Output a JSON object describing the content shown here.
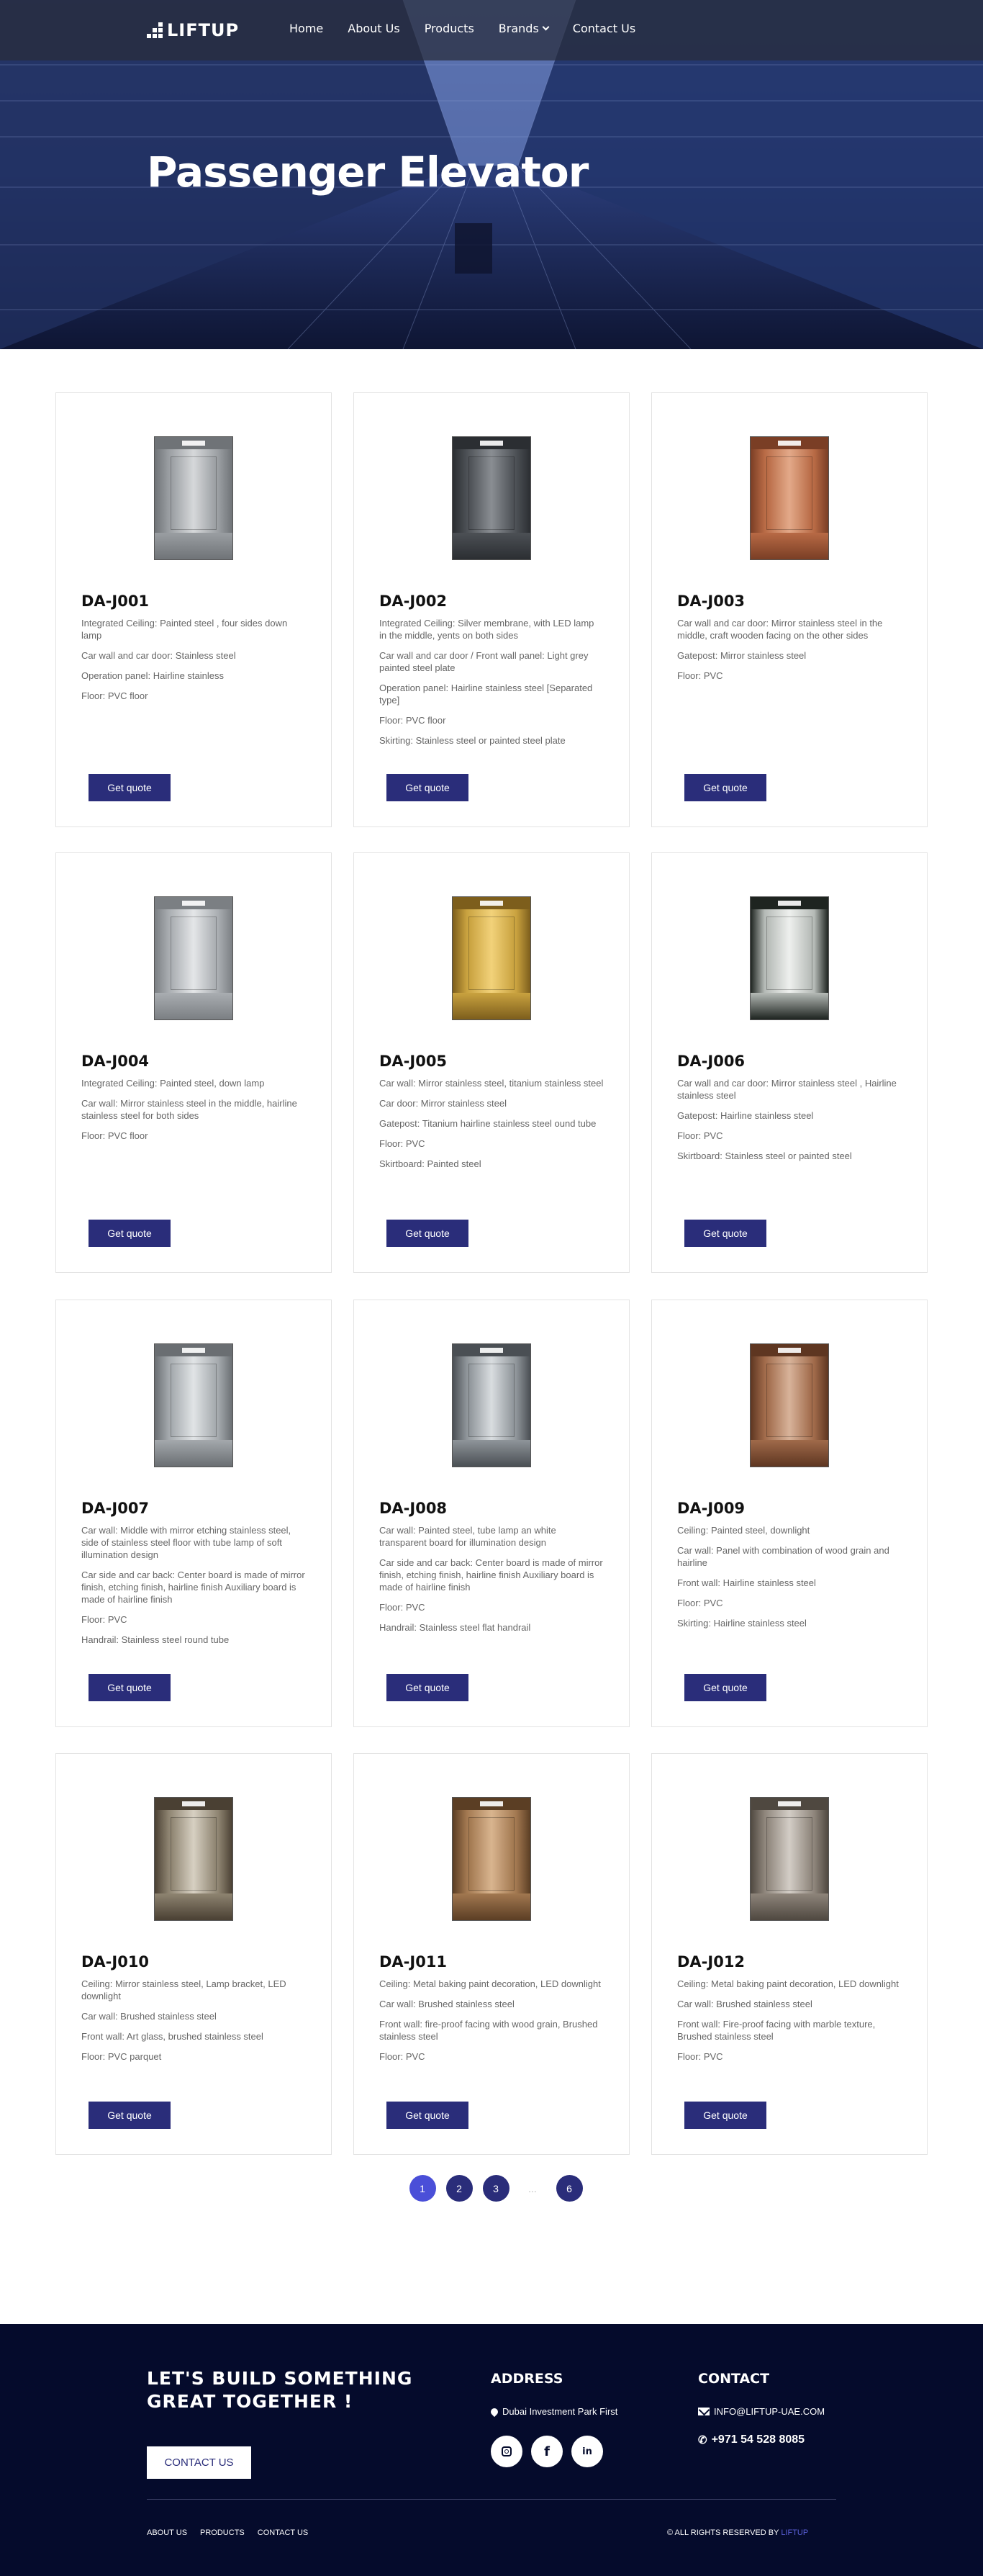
{
  "header": {
    "logo_text": "LIFTUP",
    "nav": [
      {
        "label": "Home"
      },
      {
        "label": "About Us"
      },
      {
        "label": "Products"
      },
      {
        "label": "Brands"
      },
      {
        "label": "Contact Us"
      }
    ],
    "title": "Passenger Elevator"
  },
  "products": [
    {
      "code": "DA-J001",
      "specs": [
        "Integrated Ceiling: Painted steel , four sides down lamp",
        "Car wall and car door: Stainless steel",
        "Operation panel: Hairline stainless",
        "Floor: PVC floor"
      ],
      "button": "Get quote",
      "tone": [
        "#d6d8da",
        "#9a9ea2",
        "#6f7377"
      ]
    },
    {
      "code": "DA-J002",
      "specs": [
        "Integrated Ceiling: Silver membrane, with LED lamp in the middle, yents on both sides",
        "Car wall and car door / Front wall panel: Light grey painted steel plate",
        "Operation panel: Hairline stainless steel [Separated type]",
        "Floor: PVC floor",
        "Skirting: Stainless steel or painted steel plate"
      ],
      "button": "Get quote",
      "tone": [
        "#8a8e93",
        "#4c5055",
        "#2b2e32"
      ]
    },
    {
      "code": "DA-J003",
      "specs": [
        "Car wall and car door: Mirror stainless steel in the middle, craft wooden facing on the other sides",
        "Gatepost: Mirror stainless steel",
        "Floor: PVC"
      ],
      "button": "Get quote",
      "tone": [
        "#e3a989",
        "#b86a45",
        "#7a3e25"
      ]
    },
    {
      "code": "DA-J004",
      "specs": [
        "Integrated Ceiling: Painted steel, down lamp",
        "Car wall: Mirror stainless steel in the middle, hairline stainless steel for both sides",
        "Floor: PVC floor"
      ],
      "button": "Get quote",
      "tone": [
        "#e4e6e8",
        "#a9adb1",
        "#7b7f83"
      ]
    },
    {
      "code": "DA-J005",
      "specs": [
        "Car wall: Mirror stainless steel, titanium stainless steel",
        "Car door: Mirror stainless steel",
        "Gatepost: Titanium hairline stainless steel ound tube",
        "Floor: PVC",
        "Skirtboard: Painted steel"
      ],
      "button": "Get quote",
      "tone": [
        "#f2d27a",
        "#c9a23f",
        "#7d5e1c"
      ]
    },
    {
      "code": "DA-J006",
      "specs": [
        "Car wall and car door: Mirror stainless steel , Hairline stainless steel",
        "Gatepost: Hairline stainless steel",
        "Floor: PVC",
        "Skirtboard: Stainless steel or painted steel"
      ],
      "button": "Get quote",
      "tone": [
        "#eef0ee",
        "#b5bab6",
        "#1e2420"
      ]
    },
    {
      "code": "DA-J007",
      "specs": [
        "Car wall: Middle with mirror etching stainless steel, side of stainless steel floor with tube lamp of soft illumination design",
        "Car side and car back: Center board is made of mirror finish, etching finish, hairline finish Auxiliary board is made of hairline finish",
        "Floor: PVC",
        "Handrail: Stainless steel round tube"
      ],
      "button": "Get quote",
      "tone": [
        "#e1e4e6",
        "#a4a9ad",
        "#6a6e72"
      ]
    },
    {
      "code": "DA-J008",
      "specs": [
        "Car wall: Painted steel, tube lamp an white transparent board for illumination design",
        "Car side and car back: Center board is made of mirror finish, etching finish, hairline finish Auxiliary board is made of hairline finish",
        "Floor: PVC",
        "Handrail: Stainless steel flat handrail"
      ],
      "button": "Get quote",
      "tone": [
        "#d9dde0",
        "#8f959a",
        "#4a4f54"
      ]
    },
    {
      "code": "DA-J009",
      "specs": [
        "Ceiling: Painted steel, downlight",
        "Car wall: Panel with combination of wood grain and hairline",
        "Front wall: Hairline stainless steel",
        "Floor: PVC",
        "Skirting: Hairline stainless steel"
      ],
      "button": "Get quote",
      "tone": [
        "#d8b39a",
        "#a06a4a",
        "#5e3621"
      ]
    },
    {
      "code": "DA-J010",
      "specs": [
        "Ceiling: Mirror stainless steel, Lamp bracket, LED downlight",
        "Car wall: Brushed stainless steel",
        "Front wall: Art glass, brushed stainless steel",
        "Floor: PVC parquet"
      ],
      "button": "Get quote",
      "tone": [
        "#d7d0c2",
        "#8e8471",
        "#4a4033"
      ]
    },
    {
      "code": "DA-J011",
      "specs": [
        "Ceiling: Metal baking paint decoration, LED downlight",
        "Car wall: Brushed stainless steel",
        "Front wall: fire-proof facing with wood grain, Brushed stainless steel",
        "Floor: PVC"
      ],
      "button": "Get quote",
      "tone": [
        "#d9b58f",
        "#a27850",
        "#5b3e24"
      ]
    },
    {
      "code": "DA-J012",
      "specs": [
        "Ceiling: Metal baking paint decoration, LED downlight",
        "Car wall: Brushed stainless steel",
        "Front wall: Fire-proof facing with marble texture, Brushed stainless steel",
        "Floor: PVC"
      ],
      "button": "Get quote",
      "tone": [
        "#d3cdc6",
        "#8e857b",
        "#4f4840"
      ]
    }
  ],
  "pagination": {
    "pages": [
      "1",
      "2",
      "3"
    ],
    "ellipsis": "...",
    "last": "6",
    "current": "1"
  },
  "footer": {
    "cta_line1": "LET'S BUILD SOMETHING",
    "cta_line2": "GREAT TOGETHER !",
    "cta_button": "CONTACT US",
    "address_title": "ADDRESS",
    "address": "Dubai Investment Park First",
    "contact_title": "CONTACT",
    "email": "INFO@LIFTUP-UAE.COM",
    "phone": "+971 54 528 8085",
    "social": [
      "instagram-icon",
      "facebook-icon",
      "linkedin-icon"
    ],
    "links": [
      "ABOUT US",
      "PRODUCTS",
      "CONTACT US"
    ],
    "copyright": "© ALL RIGHTS RESERVED BY",
    "copyright_brand": "LIFTUP"
  },
  "colors": {
    "brand": "#2a2d7a",
    "active_page": "#4a4fd8",
    "footer_bg": "#050b2c",
    "hero": "#2a3c78"
  }
}
